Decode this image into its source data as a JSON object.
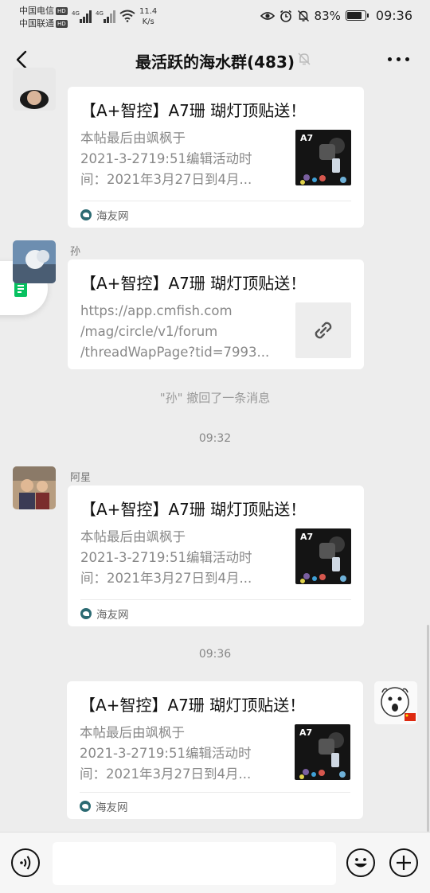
{
  "status_bar": {
    "carrier1": "中国电信",
    "carrier2": "中国联通",
    "hd": "HD",
    "net_type": "4G",
    "speed_value": "11.4",
    "speed_unit": "K/s",
    "battery_percent": "83%",
    "battery_level": 0.83,
    "time": "09:36"
  },
  "header": {
    "title": "最活跃的海水群(483)"
  },
  "shared_card": {
    "title": "【A+智控】A7珊 瑚灯顶贴送！",
    "desc": [
      "本帖最后由飒枫于",
      "2021-3-2719:51编辑活动时",
      "间：2021年3月27日到4月..."
    ],
    "source": "海友网",
    "thumb_label": "A7"
  },
  "messages": {
    "m1": {
      "sender": ""
    },
    "m2": {
      "sender": "孙",
      "title": "【A+智控】A7珊 瑚灯顶贴送！",
      "url": [
        "https://app.cmfish.com",
        "/mag/circle/v1/forum",
        "/threadWapPage?tid=7993..."
      ]
    },
    "recall": "\"孙\" 撤回了一条消息",
    "time1": "09:32",
    "m3": {
      "sender": "阿星"
    },
    "time2": "09:36"
  },
  "input_bar": {
    "voice_icon": "voice-icon",
    "emoji_icon": "emoji-icon",
    "plus_icon": "plus-icon"
  },
  "colors": {
    "background": "#ededed",
    "accent": "#07c160"
  }
}
